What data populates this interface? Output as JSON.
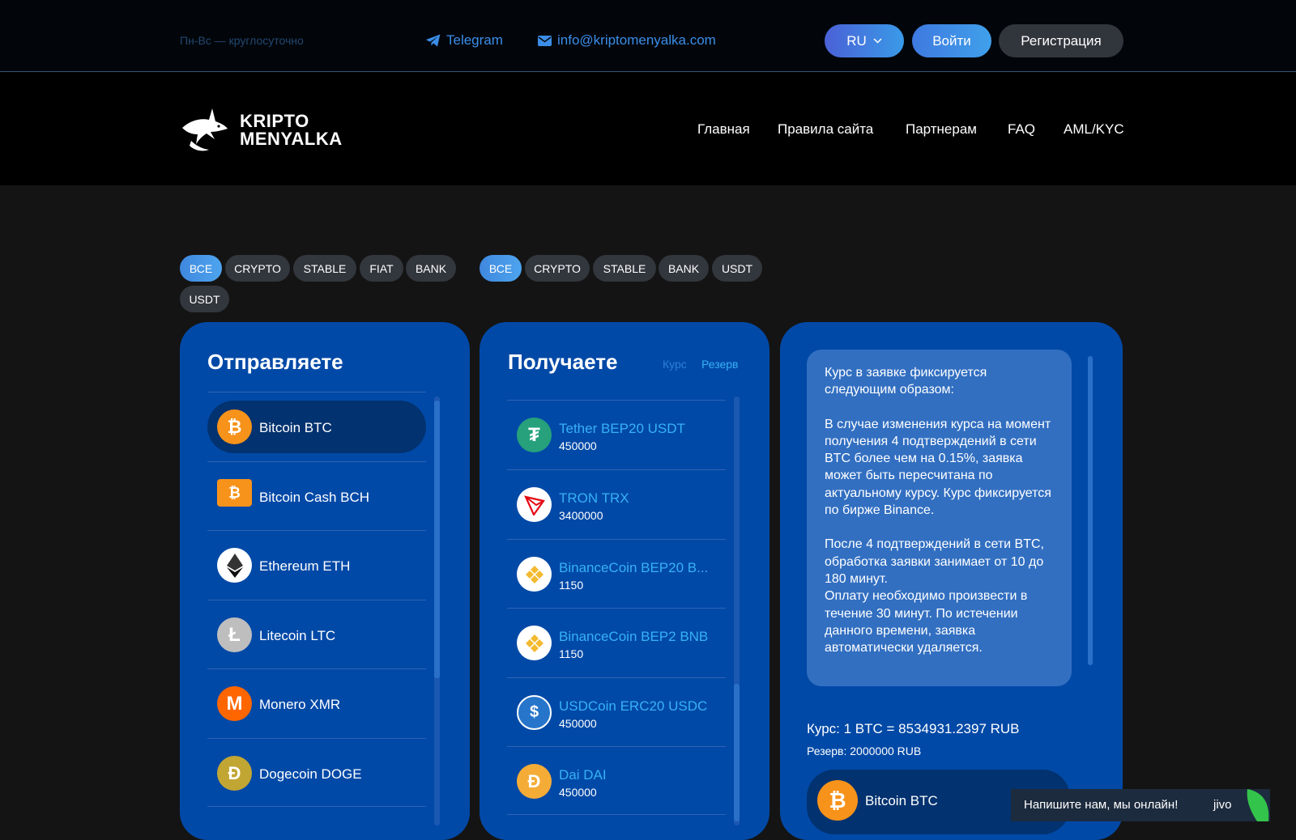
{
  "topbar": {
    "hours": "Пн-Вс — круглосуточно",
    "telegram": "Telegram",
    "email": "info@kriptomenyalka.com",
    "lang": "RU",
    "login": "Войти",
    "register": "Регистрация"
  },
  "logo": {
    "line1": "KRIPTO",
    "line2": "MENYALKA"
  },
  "nav": [
    "Главная",
    "Правила сайта",
    "Партнерам",
    "FAQ",
    "AML/KYC"
  ],
  "filters_send": [
    "ВСЕ",
    "CRYPTO",
    "STABLE",
    "FIAT",
    "BANK",
    "USDT"
  ],
  "filters_receive": [
    "ВСЕ",
    "CRYPTO",
    "STABLE",
    "BANK",
    "USDT"
  ],
  "send": {
    "title": "Отправляете",
    "items": [
      {
        "name": "Bitcoin BTC",
        "icon": "bitcoin-icon"
      },
      {
        "name": "Bitcoin Cash BCH",
        "icon": "bitcoin-cash-icon"
      },
      {
        "name": "Ethereum ETH",
        "icon": "ethereum-icon"
      },
      {
        "name": "Litecoin LTC",
        "icon": "litecoin-icon"
      },
      {
        "name": "Monero XMR",
        "icon": "monero-icon"
      },
      {
        "name": "Dogecoin DOGE",
        "icon": "dogecoin-icon"
      }
    ]
  },
  "receive": {
    "title": "Получаете",
    "rate_tab": "Курс",
    "reserve_tab": "Резерв",
    "items": [
      {
        "name": "Tether BEP20 USDT",
        "amount": "450000",
        "icon": "tether-icon"
      },
      {
        "name": "TRON TRX",
        "amount": "3400000",
        "icon": "tron-icon"
      },
      {
        "name": "BinanceCoin BEP20 B...",
        "amount": "1150",
        "icon": "binance-icon"
      },
      {
        "name": "BinanceCoin BEP2 BNB",
        "amount": "1150",
        "icon": "binance-icon"
      },
      {
        "name": "USDCoin ERC20 USDC",
        "amount": "450000",
        "icon": "usdc-icon"
      },
      {
        "name": "Dai DAI",
        "amount": "450000",
        "icon": "dai-icon"
      }
    ]
  },
  "info": {
    "p1": "Курс в заявке фиксируется следующим образом:",
    "p2": "В случае изменения курса на момент получения 4 подтверждений в сети BTC более чем на 0.15%, заявка может быть пересчитана по актуальному курсу. Курс фиксируется по бирже Binance.",
    "p3": "После 4 подтверждений в сети BTC, обработка заявки занимает от 10 до 180 минут.",
    "p4": "Оплату необходимо произвести в течение 30 минут. По истечении данного времени, заявка автоматически удаляется."
  },
  "rate": {
    "label": "Курс:",
    "value": "1 BTC = 8534931.2397 RUB"
  },
  "reserve": {
    "label": "Резерв:",
    "value": "2000000 RUB"
  },
  "selected": {
    "name": "Bitcoin BTC"
  },
  "chat": {
    "text": "Напишите нам, мы онлайн!",
    "brand": "jivo"
  },
  "colors": {
    "panel": "#0149a7",
    "accent": "#3b8de8",
    "link": "#37b1f5"
  }
}
